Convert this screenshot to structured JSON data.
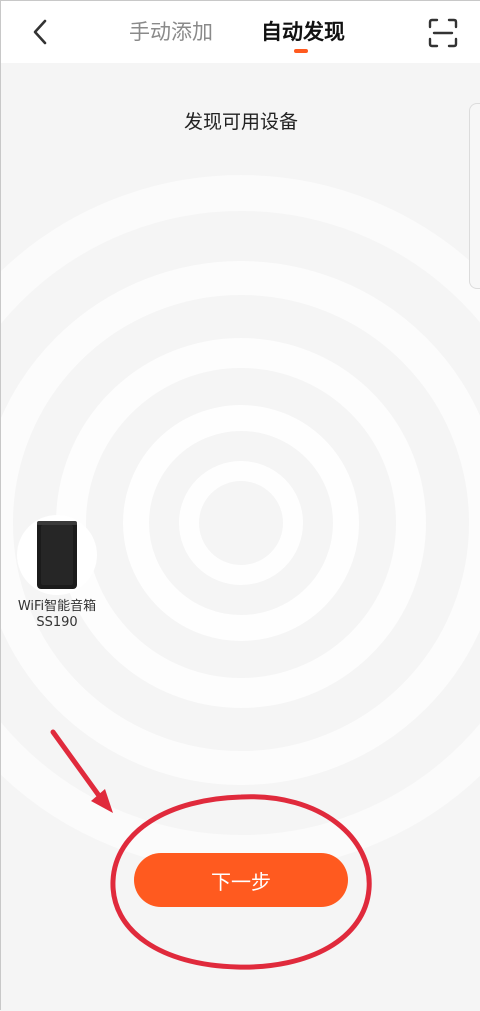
{
  "header": {
    "tabs": [
      {
        "label": "手动添加",
        "active": false
      },
      {
        "label": "自动发现",
        "active": true
      }
    ],
    "back_icon": "chevron-left-icon",
    "scan_icon": "scan-icon"
  },
  "main": {
    "title": "发现可用设备",
    "device": {
      "name": "WiFi智能音箱",
      "model": "SS190"
    },
    "next_button_label": "下一步"
  },
  "colors": {
    "accent": "#ff5a1f",
    "annotation_red": "#e02a3c"
  }
}
